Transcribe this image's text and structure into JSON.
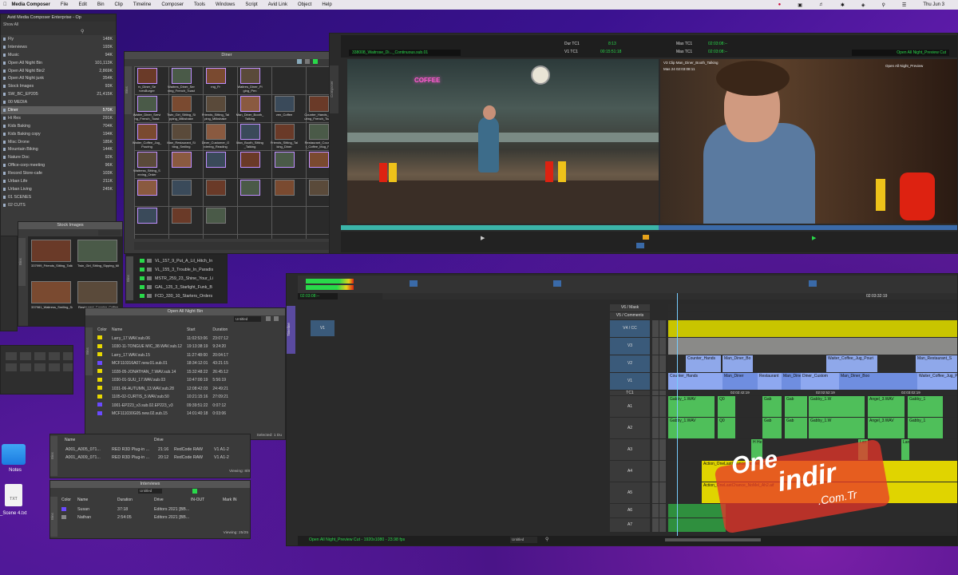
{
  "menubar": {
    "app": "Media Composer",
    "items": [
      "File",
      "Edit",
      "Bin",
      "Clip",
      "Timeline",
      "Composer",
      "Tools",
      "Windows",
      "Script",
      "Avid Link",
      "Object",
      "Help"
    ],
    "clock": "Thu Jun 3"
  },
  "project": {
    "title": "Avid Media Composer Enterprise - Op",
    "filter": "Show All",
    "items": [
      {
        "name": "Fly",
        "size": "148K"
      },
      {
        "name": "Interviews",
        "size": "193K"
      },
      {
        "name": "Music",
        "size": "94K"
      },
      {
        "name": "Open All Night Bin",
        "size": "101,113K"
      },
      {
        "name": "Open All Night Bin2",
        "size": "2,869K"
      },
      {
        "name": "Open All Night junk",
        "size": "354K"
      },
      {
        "name": "Stock Images",
        "size": "93K"
      },
      {
        "name": "SW_BC_EP205",
        "size": "21,415K"
      },
      {
        "name": "00 MEDIA",
        "size": ""
      },
      {
        "name": "Diner",
        "size": "570K"
      },
      {
        "name": "Hi Res",
        "size": "291K"
      },
      {
        "name": "Kids Baking",
        "size": "704K"
      },
      {
        "name": "Kids Baking copy",
        "size": "194K"
      },
      {
        "name": "Misc Drone",
        "size": "185K"
      },
      {
        "name": "Mountain Biking",
        "size": "144K"
      },
      {
        "name": "Nature Doc",
        "size": "92K"
      },
      {
        "name": "Office-corp meeting",
        "size": "96K"
      },
      {
        "name": "Record Store-cafe",
        "size": "103K"
      },
      {
        "name": "Urban Life",
        "size": "211K"
      },
      {
        "name": "Urban Living",
        "size": "245K"
      },
      {
        "name": "01 SCENES",
        "size": ""
      },
      {
        "name": "02 CUTS",
        "size": ""
      }
    ]
  },
  "diner": {
    "title": "Diner",
    "labels": [
      "rv_Diner_Se rvesBurger",
      "Waitres_Diner_Ser ving_French_Toast",
      "rng_Fr",
      "Waitres_Diner_Pl ging_Pen",
      "Waiter_Diner_Servi ng_French_Toast",
      "Twin_Girl_Sitting_Si pping_Milkshake",
      "Friends_Sitting_Tal ping_Milkshake",
      "Man_Diner_Booth_ Talking",
      "ven_Coffee",
      "Counter_Hands_Po uring_French_Toast",
      "Waiter_Coffee_Jug_ Pouring",
      "Man_Restaurant_Si tting_Smiling",
      "Diner_Customer_O rdering_Reading",
      "Man_Booth_Sitting _Talking",
      "Friends_Sitting_Tal king_Diner",
      "Restaurant_Counte r_Coffee_Mug_Po",
      "Waitress_Sitting_S erving_Order"
    ]
  },
  "stock": {
    "title": "Stock Images",
    "labels": [
      "337999_Friends_Sitting_Talking_Diner_By_Continuous",
      "Twin_Girl_Sitting_Sipping_Milkshake_By_Co",
      "337981_Waitress_Smiling_Serving_Order_By_Continu",
      "Restaurant_Counter_Coffee"
    ]
  },
  "list2": {
    "items": [
      "VL_157_9_Put_A_Lil_Hitch_In",
      "VL_155_3_Trouble_In_Paradis",
      "MSTR_259_23_Shine_Your_Li",
      "GAL_125_3_Starlight_Funk_B",
      "FCD_330_10_Starters_Orders"
    ]
  },
  "oan": {
    "title": "Open All Night Bin",
    "view": "Untitled",
    "headers": [
      "Color",
      "Name",
      "Start",
      "Duration"
    ],
    "rows": [
      {
        "name": "Larry_17.WAV.sub.06",
        "start": "11:02:53:06",
        "dur": "23:07:12",
        "color": "#e8d800"
      },
      {
        "name": "1030-11-TONGUE MIC_38.WAV.sub.12",
        "start": "19:13:38:19",
        "dur": "9:24:20",
        "color": "#e8d800"
      },
      {
        "name": "Larry_17.WAV.sub.15",
        "start": "11:27:48:00",
        "dur": "20:04:17",
        "color": "#e8d800"
      },
      {
        "name": "MCF110316A07.new.01.sub.01",
        "start": "18:34:12:01",
        "dur": "43:21:15",
        "color": "#6a4aff"
      },
      {
        "name": "1028-05-JONATHAN_7.WAV.sub.14",
        "start": "15:32:48:22",
        "dur": "26:45:12",
        "color": "#e8d800"
      },
      {
        "name": "1030-01-SUU_17.WAV.sub.03",
        "start": "10:47:00:19",
        "dur": "5:56:19",
        "color": "#e8d800"
      },
      {
        "name": "1031-06-AUTUMN_13.WAV.sub.28",
        "start": "12:08:42:03",
        "dur": "24:49:21",
        "color": "#e8d800"
      },
      {
        "name": "1105-02-CURTIS_5.WAV.sub.50",
        "start": "10:21:15:16",
        "dur": "27:09:21",
        "color": "#e8d800"
      },
      {
        "name": "1001-EP223_v3.sub.02.EP223_v3",
        "start": "09:39:51:22",
        "dur": "0:07:12",
        "color": "#6a4aff"
      },
      {
        "name": "MCF111030G05.new.02.sub.15",
        "start": "14:01:40:18",
        "dur": "0:03:06",
        "color": "#6a4aff"
      }
    ],
    "status": "Selected: 1 Du"
  },
  "small": {
    "headers": [
      "Name",
      "Drive"
    ],
    "rows": [
      {
        "name": "A001_A005_071...",
        "drive": "RED R3D Plug-in ...",
        "tc": "21:16",
        "codec": "RedCode RAW",
        "trk": "V1 A1-2"
      },
      {
        "name": "A001_A009_071...",
        "drive": "RED R3D Plug-in ...",
        "tc": "20:12",
        "codec": "RedCode RAW",
        "trk": "V1 A1-2"
      }
    ],
    "status": "Viewing: 8/8"
  },
  "interviews": {
    "title": "Interviews",
    "view": "Untitled",
    "headers": [
      "Color",
      "Name",
      "Duration",
      "Drive",
      "IN-OUT",
      "Mark IN"
    ],
    "rows": [
      {
        "name": "Susan",
        "dur": "37:18",
        "drive": "Editors 2021 [BB...",
        "color": "#6a4aff"
      },
      {
        "name": "Nathan",
        "dur": "2:54:05",
        "drive": "Editors 2021 [BB...",
        "color": "#888"
      }
    ],
    "status": "Viewing: 25/25"
  },
  "desktop": {
    "notes": "Notes",
    "file": "_Scene 4.txt"
  },
  "composer": {
    "src_name": "338008_Waitrose_Di..._Continuous.sub.01",
    "rec_name": "Open All Night_Preview Cut",
    "dur_label": "Dur  TC1",
    "dur_val": "8:13",
    "v1_label": "V1  TC1",
    "v1_val": "00:15:51:18",
    "mas_label": "Mas  TC1",
    "mas_val": "02:03:08:--",
    "mas_val2": "02:03:08:--",
    "rec_clip": "V3 Clip Man_Diner_Booth_Talking",
    "rec_tc": "Mas  24  02:03:08:11",
    "rec_seq": "Open All Night_Preview",
    "sign": "COFFEE",
    "vert_label": "Composer"
  },
  "timeline": {
    "ruler_tc": "02:03:32:19",
    "pos_tc": "02:03:08:--",
    "footer": "Open All Night_Preview Cut - 1920x1080 - 23.98 fps",
    "footer_view": "Untitled",
    "tracks": [
      "V6 / Mask",
      "V5 / Comments",
      "V4 / CC",
      "V3",
      "V2",
      "V1",
      "TC1",
      "A1",
      "A2",
      "A3",
      "A4",
      "A5",
      "A6",
      "A7"
    ],
    "tc_marks": [
      "02:02:42:19",
      "02:02:52:19",
      "02:03:02:19",
      "02:03:12:19",
      "02:03:22:19",
      "02:03:32:19"
    ],
    "v2_clips": [
      "Counter_Hands",
      "Man_Diner_Bo",
      "Waiter_Coffee_Jug_Pouri",
      "Man_Restaurant_S",
      "Man_Diner_Boo",
      "1D0"
    ],
    "v1_clips": [
      "Counter_Hands",
      "Man_Diner",
      "Restaurant",
      "Man_Dine",
      "Diner_Custom",
      "Man_Diner_Boo",
      "Waiter_Coffee_Jug_Pour",
      "Man_Restaurant_S",
      "Man_Diner_Bo",
      "1D01",
      "1102"
    ],
    "a1_clips": [
      "Gabby_1.WAV",
      "Q0",
      "Gab",
      "Gab",
      "Gabby_1.W",
      "Angel_3.WAV",
      "Gabby_1",
      "Gabby_1.WAV",
      "Gabby_1.WAV",
      "Gabby_1.WA",
      "Gabby_1.WA",
      "Gabby_1.WAV"
    ],
    "a2_clips": [
      "Gabby_1.WAV",
      "Q0",
      "Gab",
      "Gab",
      "Gabby_1.W",
      "Angel_3.WAV",
      "Gabby_1",
      "Gabby_1.WAV",
      "Gabby_1.WAV",
      "Gabby_1.WA",
      "Gabby_1.WA",
      "Gabby_1.WAV"
    ],
    "a3_clips": [
      "H He",
      "Larr",
      "Larr"
    ],
    "a4_clip": "Action_OneLastChance_NoMel_Ah2.aif",
    "a5_clip": "Action_OneLastChance_NoMel_Ah2.aif",
    "a6_clip": "Action_BattlingMasters_NoMel_Ah2.aif",
    "a7_clip": "Action_BattlingMasters_NoMel_Ah2.aif",
    "music_clip": "MC8_Tension_AlmondaresEx",
    "music_clip2": "MC8_Tension_AlmondaresEx",
    "cym": "Cym_Swell_R",
    "cym2": "Cym_Swell_R"
  },
  "watermark": {
    "line1": "One",
    "line2": "indir",
    "line3": ".Com.Tr"
  },
  "colors": {
    "accent_green": "#29d94a",
    "audio_green": "#4fbf5a",
    "video_blue": "#6f8ee0",
    "music_yellow": "#e0d400",
    "music_orange": "#ee8a1c",
    "cc_yellow": "#c9c500"
  }
}
